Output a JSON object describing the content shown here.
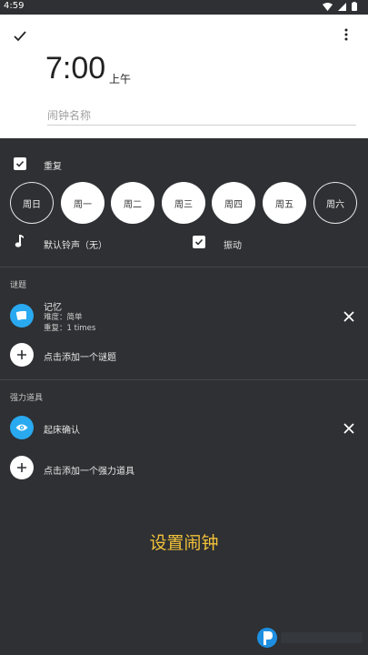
{
  "status": {
    "time": "4:59"
  },
  "header": {
    "time": "7:00",
    "ampm": "上午",
    "name_placeholder": "闹钟名称"
  },
  "repeat": {
    "label": "重复",
    "checked": true,
    "days": [
      {
        "label": "周日",
        "selected": false
      },
      {
        "label": "周一",
        "selected": true
      },
      {
        "label": "周二",
        "selected": true
      },
      {
        "label": "周三",
        "selected": true
      },
      {
        "label": "周四",
        "selected": true
      },
      {
        "label": "周五",
        "selected": true
      },
      {
        "label": "周六",
        "selected": false
      }
    ]
  },
  "sound": {
    "label": "默认铃声（无）",
    "icon": "music-note-icon"
  },
  "vibrate": {
    "label": "振动",
    "checked": true
  },
  "puzzles": {
    "title": "谜题",
    "item": {
      "name": "记忆",
      "difficulty": "难度：简单",
      "repeat": "重复：1 times",
      "icon": "cards-icon"
    },
    "add_label": "点击添加一个谜题"
  },
  "powerups": {
    "title": "强力道具",
    "item": {
      "name": "起床确认",
      "icon": "eye-icon"
    },
    "add_label": "点击添加一个强力道具"
  },
  "set_alarm": "设置闹钟",
  "colors": {
    "accent_blue": "#29a9f0",
    "accent_yellow": "#f3c23a",
    "background": "#2e3033"
  }
}
